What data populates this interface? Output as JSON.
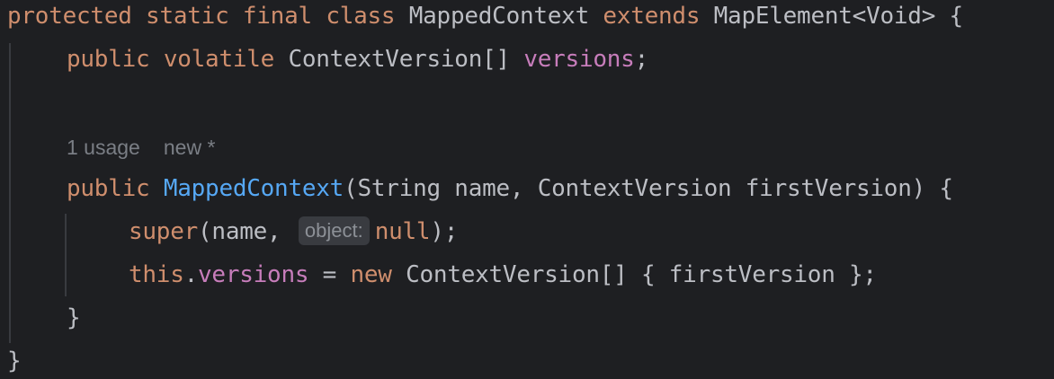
{
  "code": {
    "line1": {
      "protected": "protected",
      "static": "static",
      "final": "final",
      "class": "class",
      "class_name": "MappedContext",
      "extends": "extends",
      "parent": "MapElement<Void>",
      "brace": "{"
    },
    "line2": {
      "public": "public",
      "volatile": "volatile",
      "type": "ContextVersion[]",
      "field": "versions",
      "semi": ";"
    },
    "hints": {
      "usages": "1 usage",
      "new_author": "new *"
    },
    "line4": {
      "public": "public",
      "method_name": "MappedContext",
      "params": "(String name, ContextVersion firstVersion) {"
    },
    "line5": {
      "super": "super",
      "args_start": "(name,",
      "inlay_hint": "object:",
      "null": "null",
      "args_end": ");"
    },
    "line6": {
      "this": "this",
      "dot": ".",
      "field": "versions",
      "assign": " = ",
      "new": "new",
      "rest": " ContextVersion[] { firstVersion };"
    },
    "line7": {
      "close": "}"
    },
    "line8": {
      "close": "}"
    }
  }
}
